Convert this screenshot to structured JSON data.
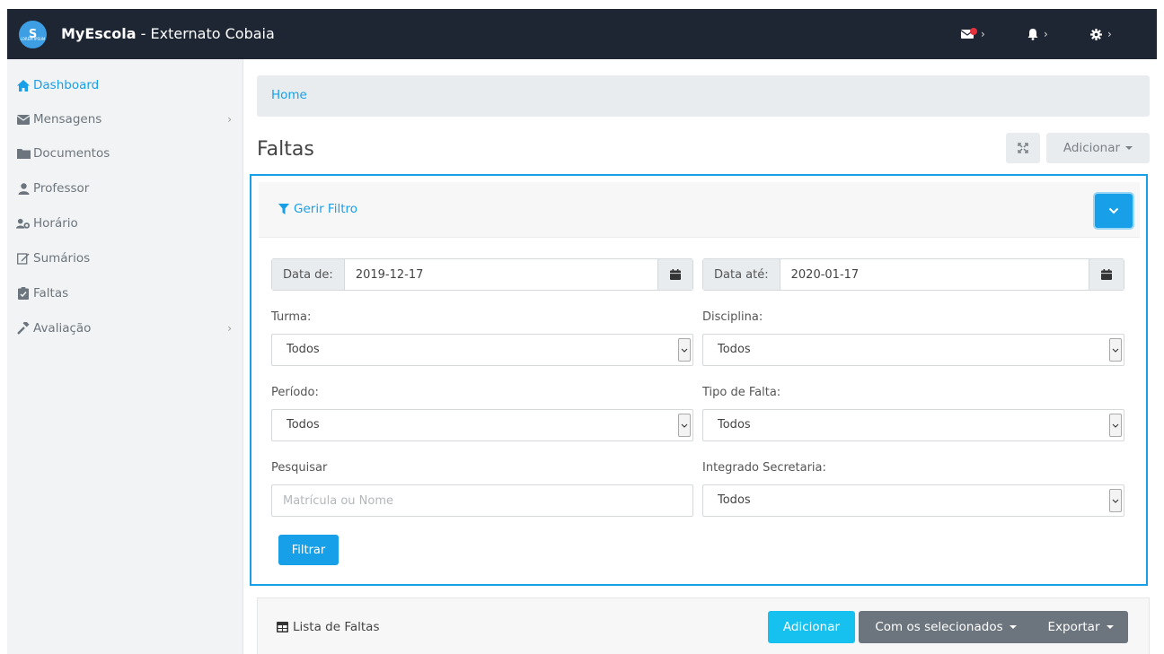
{
  "topbar": {
    "logo_text": "S",
    "logo_sub": "LOREM IPSUM",
    "brand": "MyEscola",
    "separator": " - ",
    "school": "Externato Cobaia"
  },
  "sidebar": {
    "items": [
      {
        "label": "Dashboard",
        "icon": "home-icon"
      },
      {
        "label": "Mensagens",
        "icon": "envelope-icon"
      },
      {
        "label": "Documentos",
        "icon": "folder-icon"
      },
      {
        "label": "Professor",
        "icon": "user-icon"
      },
      {
        "label": "Horário",
        "icon": "users-icon"
      },
      {
        "label": "Sumários",
        "icon": "edit-icon"
      },
      {
        "label": "Faltas",
        "icon": "clipboard-icon"
      },
      {
        "label": "Avaliação",
        "icon": "gavel-icon"
      }
    ]
  },
  "breadcrumb": {
    "home": "Home"
  },
  "page": {
    "title": "Faltas",
    "add_label": "Adicionar"
  },
  "filter": {
    "title": "Gerir Filtro",
    "date_from_label": "Data de:",
    "date_from_value": "2019-12-17",
    "date_to_label": "Data até:",
    "date_to_value": "2020-01-17",
    "turma_label": "Turma:",
    "turma_value": "Todos",
    "disciplina_label": "Disciplina:",
    "disciplina_value": "Todos",
    "periodo_label": "Período:",
    "periodo_value": "Todos",
    "tipo_label": "Tipo de Falta:",
    "tipo_value": "Todos",
    "pesquisar_label": "Pesquisar",
    "pesquisar_placeholder": "Matrícula ou Nome",
    "integrado_label": "Integrado Secretaria:",
    "integrado_value": "Todos",
    "submit_label": "Filtrar"
  },
  "list": {
    "title": "Lista de Faltas",
    "add_label": "Adicionar",
    "selected_label": "Com os selecionados",
    "export_label": "Exportar"
  },
  "colors": {
    "accent": "#17a0e8",
    "topbar": "#1e2533",
    "notification": "#e4313b"
  }
}
